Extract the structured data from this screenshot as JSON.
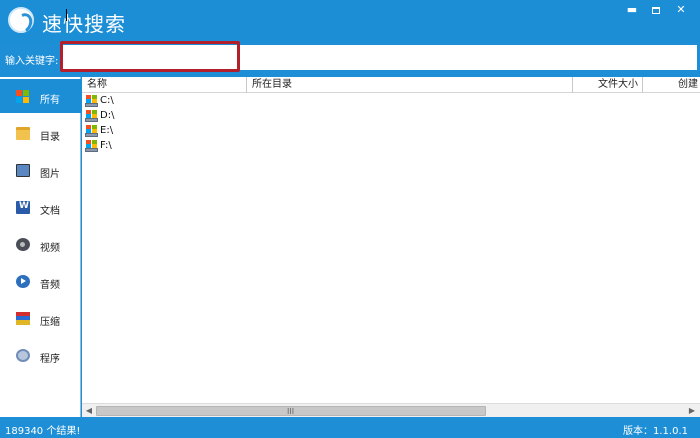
{
  "app": {
    "title": "速快搜索"
  },
  "search": {
    "label": "输入关键字:",
    "value": "",
    "placeholder": ""
  },
  "sidebar": {
    "items": [
      {
        "label": "所有",
        "icon": "all-icon"
      },
      {
        "label": "目录",
        "icon": "folder-icon"
      },
      {
        "label": "图片",
        "icon": "image-icon"
      },
      {
        "label": "文档",
        "icon": "document-icon"
      },
      {
        "label": "视频",
        "icon": "video-icon"
      },
      {
        "label": "音频",
        "icon": "audio-icon"
      },
      {
        "label": "压缩",
        "icon": "archive-icon"
      },
      {
        "label": "程序",
        "icon": "program-icon"
      }
    ],
    "selected": "所有"
  },
  "table": {
    "columns": [
      "名称",
      "所在目录",
      "文件大小",
      "创建"
    ],
    "rows": [
      {
        "name": "C:\\",
        "icon": "drive-icon"
      },
      {
        "name": "D:\\",
        "icon": "drive-icon"
      },
      {
        "name": "E:\\",
        "icon": "drive-icon"
      },
      {
        "name": "F:\\",
        "icon": "drive-icon"
      }
    ]
  },
  "scrollbar": {
    "grip": "III"
  },
  "status": {
    "count_text": "189340 个结果!",
    "version_text": "版本：1.1.0.1"
  },
  "colors": {
    "accent": "#1e8fd6",
    "highlight_border": "#b3202c"
  }
}
